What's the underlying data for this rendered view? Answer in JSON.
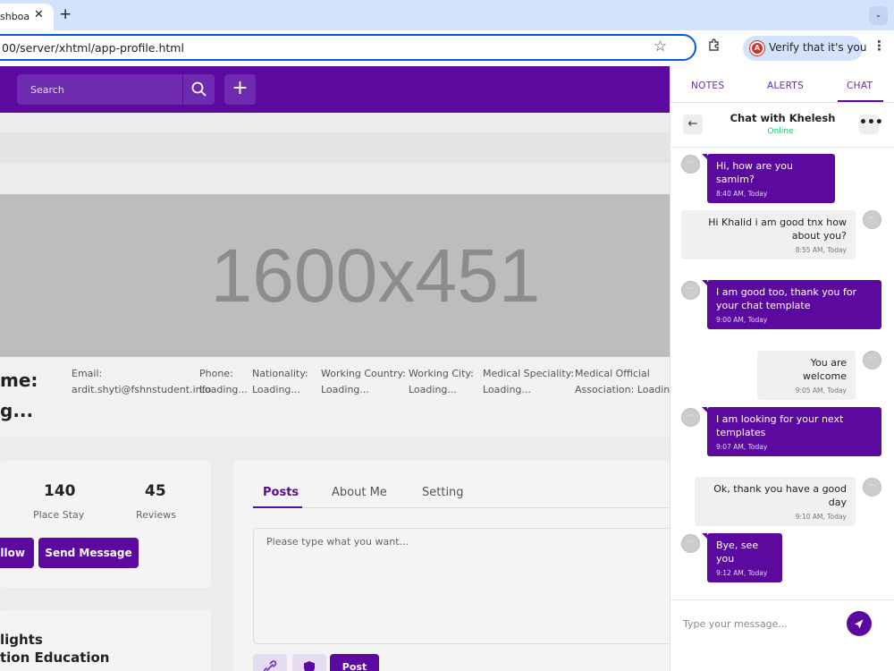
{
  "browser": {
    "tab_title": "shboard",
    "tab_close": "✕",
    "new_tab": "+",
    "tab_menu": "⌄",
    "url": "00/server/xhtml/app-profile.html",
    "verify_text": "Verify that it's you",
    "verify_avatar": "A",
    "menu": "⋮"
  },
  "header": {
    "search_placeholder": "Search",
    "plus": "+"
  },
  "banner": {
    "text": "1600x451"
  },
  "profile": {
    "name_line1": "me:",
    "name_line2": "g...",
    "fields": [
      {
        "label": "Email:",
        "value": "ardit.shyti@fshnstudent.info"
      },
      {
        "label": "Phone:",
        "value": "Loading..."
      },
      {
        "label": "Nationality:",
        "value": "Loading..."
      },
      {
        "label": "Working Country:",
        "value": "Loading..."
      },
      {
        "label": "Working City:",
        "value": "Loading..."
      },
      {
        "label": "Medical Speciality:",
        "value": "Loading..."
      },
      {
        "label": "Medical Official",
        "value": "Association: Loading..."
      }
    ]
  },
  "stats": [
    {
      "number": "140",
      "label": "Place Stay"
    },
    {
      "number": "45",
      "label": "Reviews"
    }
  ],
  "actions": {
    "follow": "ollow",
    "send_message": "Send Message"
  },
  "highlights": {
    "line1": "lights",
    "line2": "tion Education"
  },
  "posts": {
    "tabs": [
      "Posts",
      "About Me",
      "Setting"
    ],
    "placeholder": "Please type what you want...",
    "post_button": "Post"
  },
  "chat": {
    "tabs": [
      "NOTES",
      "ALERTS",
      "CHAT"
    ],
    "back": "←",
    "title": "Chat with Khelesh",
    "status": "Online",
    "more": "•••",
    "avatar_glyph": "···",
    "messages": [
      {
        "dir": "out",
        "text": "Hi, how are you samim?",
        "time": "8:40 AM, Today"
      },
      {
        "dir": "in",
        "text": "Hi Khalid i am good tnx how about you?",
        "time": "8:55 AM, Today"
      },
      {
        "dir": "out",
        "text": "I am good too, thank you for your chat template",
        "time": "9:00 AM, Today"
      },
      {
        "dir": "in",
        "text": "You are welcome",
        "time": "9:05 AM, Today"
      },
      {
        "dir": "out",
        "text": "I am looking for your next templates",
        "time": "9:07 AM, Today"
      },
      {
        "dir": "in",
        "text": "Ok, thank you have a good day",
        "time": "9:10 AM, Today"
      },
      {
        "dir": "out",
        "text": "Bye, see you",
        "time": "9:12 AM, Today"
      }
    ],
    "compose_placeholder": "Type your message..."
  },
  "colors": {
    "brand": "#5c099f",
    "online": "#1bc16a",
    "chrome_tab_bar": "#d3e3fd"
  },
  "icons": {
    "search": "search-icon",
    "star": "star-icon",
    "extensions": "puzzle-icon",
    "link": "link-icon",
    "shield": "shield-icon",
    "send": "send-icon"
  }
}
